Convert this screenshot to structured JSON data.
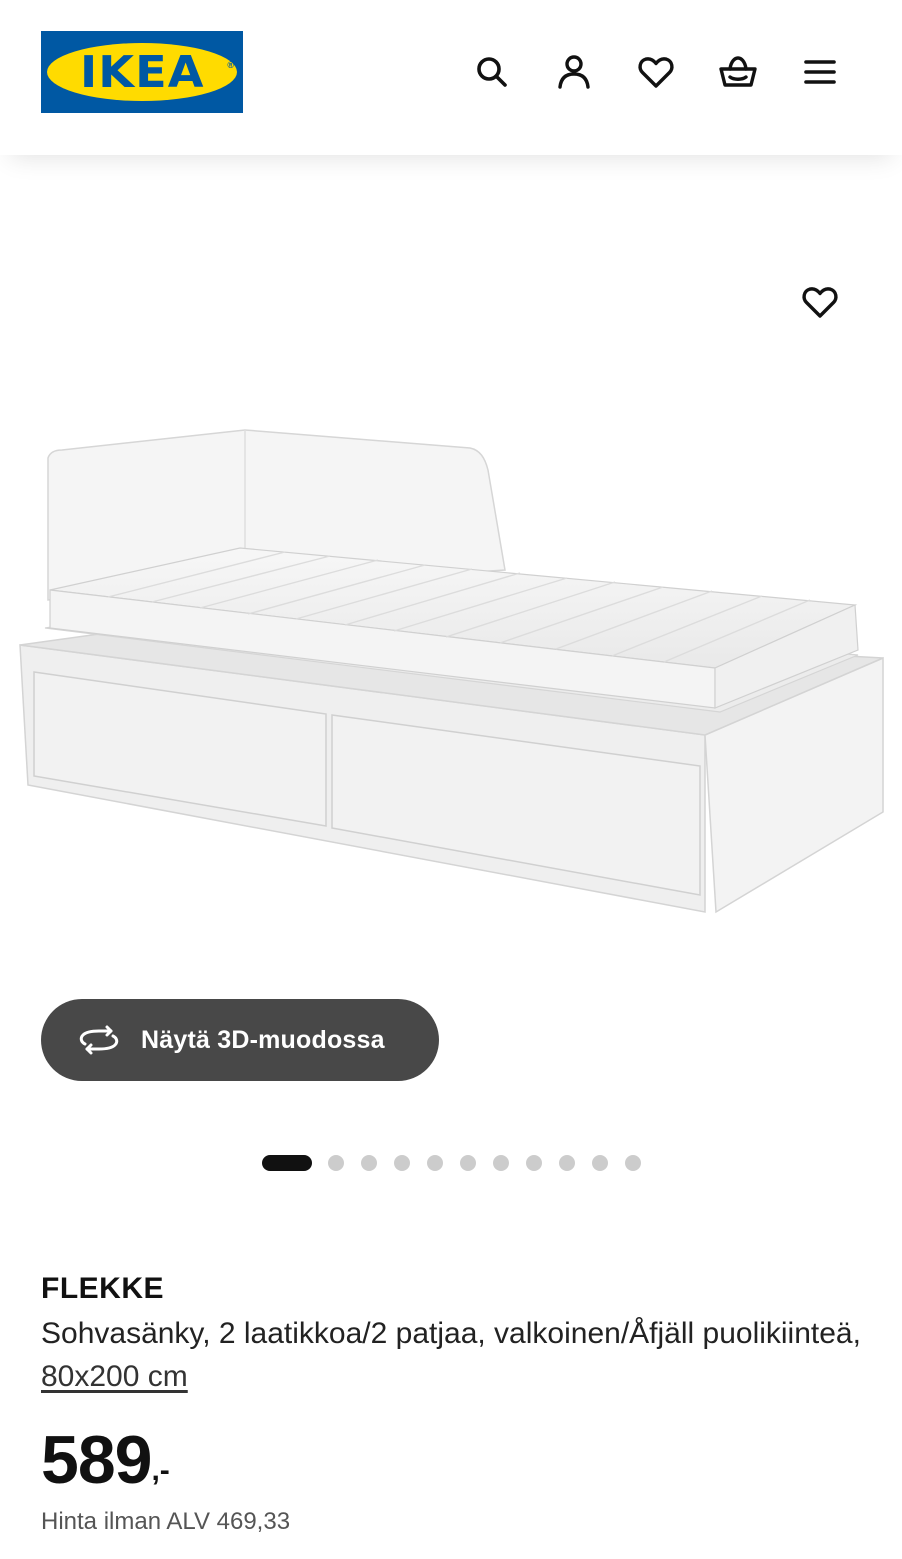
{
  "header": {
    "logo_text": "IKEA",
    "logo_registered": "®",
    "icons": [
      "search-icon",
      "user-icon",
      "heart-icon",
      "basket-icon",
      "menu-icon"
    ]
  },
  "product": {
    "brand": "FLEKKE",
    "description_main": "Sohvasänky, 2 laatikkoa/2 patjaa, valkoinen/Åfjäll puolikiinteä, ",
    "size": "80x200 cm",
    "price": "589",
    "price_suffix": ",-",
    "vat_text": "Hinta ilman ALV 469,33",
    "view3d_label": "Näytä 3D-muodossa"
  },
  "gallery": {
    "total_images": 12,
    "active_index": 0
  },
  "colors": {
    "ikea_blue": "#0058a3",
    "ikea_yellow": "#ffdb00",
    "button_dark": "#484848",
    "dot_inactive": "#cccccc",
    "dot_active": "#111111"
  }
}
